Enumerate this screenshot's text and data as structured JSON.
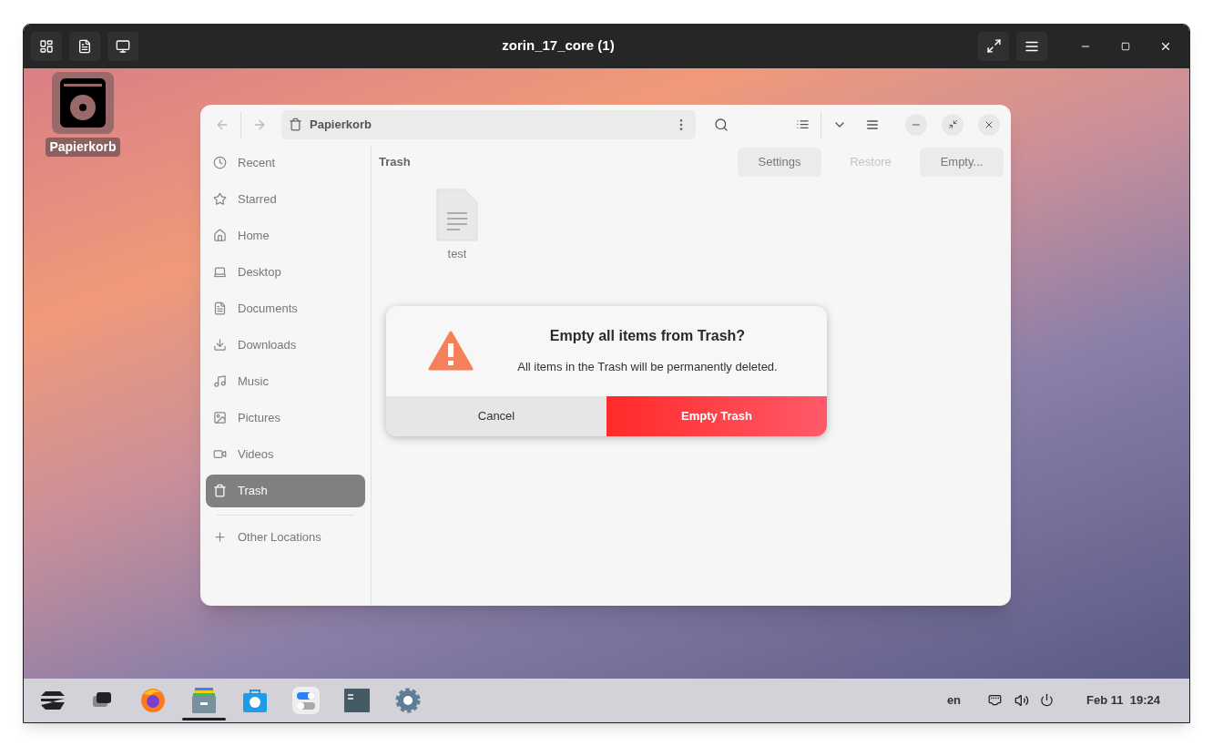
{
  "vm_window": {
    "title": "zorin_17_core (1)"
  },
  "desktop_icon": {
    "label": "Papierkorb",
    "selected": true
  },
  "file_manager": {
    "path": "Papierkorb",
    "location_title": "Trash",
    "sidebar": [
      {
        "label": "Recent",
        "selected": false
      },
      {
        "label": "Starred",
        "selected": false
      },
      {
        "label": "Home",
        "selected": false
      },
      {
        "label": "Desktop",
        "selected": false
      },
      {
        "label": "Documents",
        "selected": false
      },
      {
        "label": "Downloads",
        "selected": false
      },
      {
        "label": "Music",
        "selected": false
      },
      {
        "label": "Pictures",
        "selected": false
      },
      {
        "label": "Videos",
        "selected": false
      },
      {
        "label": "Trash",
        "selected": true
      }
    ],
    "other_locations": "Other Locations",
    "actions": [
      {
        "label": "Settings",
        "disabled": false
      },
      {
        "label": "Restore",
        "disabled": true
      },
      {
        "label": "Empty...",
        "disabled": false
      }
    ],
    "files": [
      {
        "name": "test"
      }
    ]
  },
  "dialog": {
    "title": "Empty all items from Trash?",
    "message": "All items in the Trash will be permanently deleted.",
    "cancel": "Cancel",
    "confirm": "Empty Trash"
  },
  "taskbar": {
    "apps": [
      {
        "selected": false
      },
      {
        "selected": false
      },
      {
        "selected": true
      },
      {
        "selected": false
      },
      {
        "selected": false
      },
      {
        "selected": false
      },
      {
        "selected": false
      }
    ],
    "language": "en",
    "date": "Feb 11",
    "time": "19:24"
  }
}
